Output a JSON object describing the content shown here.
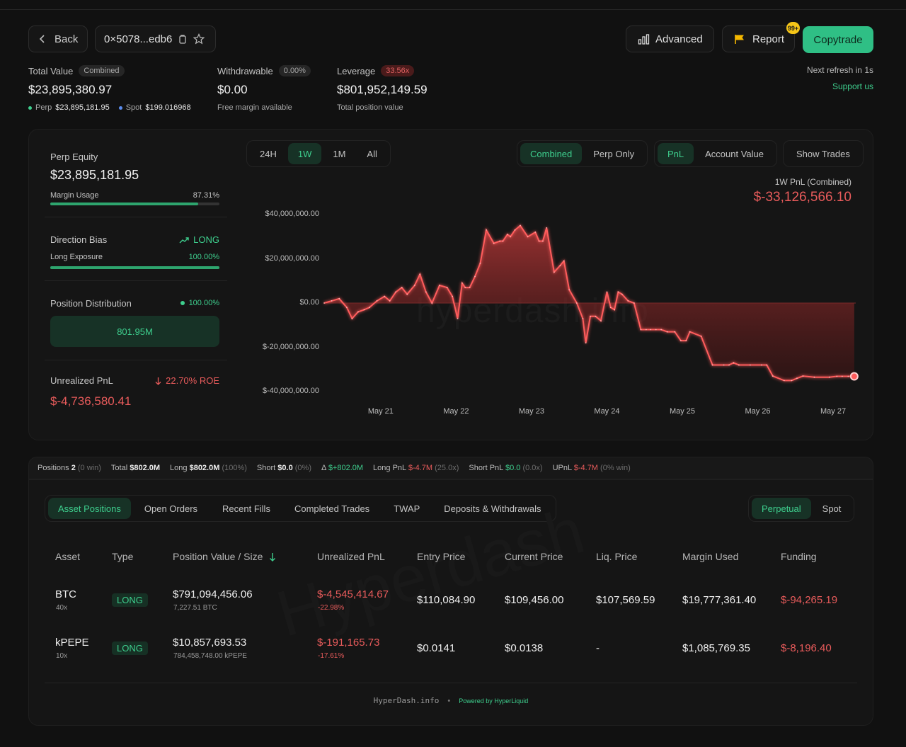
{
  "header": {
    "back_label": "Back",
    "address": "0×5078...edb6",
    "advanced_label": "Advanced",
    "report_label": "Report",
    "report_badge": "99+",
    "copytrade_label": "Copytrade"
  },
  "stats": {
    "total_value_label": "Total Value",
    "total_value_pill": "Combined",
    "total_value": "$23,895,380.97",
    "perp_label": "Perp",
    "perp_value": "$23,895,181.95",
    "spot_label": "Spot",
    "spot_value": "$199.016968",
    "withdrawable_label": "Withdrawable",
    "withdrawable_pill": "0.00%",
    "withdrawable_value": "$0.00",
    "withdrawable_sub": "Free margin available",
    "leverage_label": "Leverage",
    "leverage_pill": "33.56x",
    "leverage_value": "$801,952,149.59",
    "leverage_sub": "Total position value",
    "refresh_text": "Next refresh in 1s",
    "support_text": "Support us"
  },
  "left_panel": {
    "perp_equity_label": "Perp Equity",
    "perp_equity_value": "$23,895,181.95",
    "margin_usage_label": "Margin Usage",
    "margin_usage_value": "87.31%",
    "margin_usage_fraction": 0.8731,
    "direction_bias_label": "Direction Bias",
    "direction_bias_value": "LONG",
    "long_exposure_label": "Long Exposure",
    "long_exposure_value": "100.00%",
    "long_exposure_fraction": 1.0,
    "position_distribution_label": "Position Distribution",
    "position_distribution_value": "100.00%",
    "distribution_box_value": "801.95M",
    "unrealized_pnl_label": "Unrealized PnL",
    "unrealized_roe": "22.70% ROE",
    "unrealized_pnl_value": "$-4,736,580.41"
  },
  "chart_controls": {
    "timeframes": [
      "24H",
      "1W",
      "1M",
      "All"
    ],
    "active_timeframe": "1W",
    "modes": [
      "Combined",
      "Perp Only"
    ],
    "active_mode": "Combined",
    "metrics": [
      "PnL",
      "Account Value"
    ],
    "active_metric": "PnL",
    "show_trades_label": "Show Trades",
    "pnl_caption": "1W PnL (Combined)",
    "pnl_value": "$-33,126,566.10",
    "watermark": "hyperdash.info"
  },
  "chart_data": {
    "type": "area",
    "ytick_labels": [
      "$40,000,000.00",
      "$20,000,000.00",
      "$0.00",
      "$-20,000,000.00",
      "$-40,000,000.00"
    ],
    "yticks": [
      40000000,
      20000000,
      0,
      -20000000,
      -40000000
    ],
    "xtick_labels": [
      "May 21",
      "May 22",
      "May 23",
      "May 24",
      "May 25",
      "May 26",
      "May 27"
    ],
    "ylim": [
      -45000000,
      45000000
    ],
    "xlim": [
      0.25,
      7.3
    ],
    "x": [
      0.25,
      0.35,
      0.45,
      0.55,
      0.62,
      0.7,
      0.78,
      0.85,
      0.95,
      1.05,
      1.12,
      1.2,
      1.28,
      1.35,
      1.45,
      1.52,
      1.6,
      1.68,
      1.78,
      1.88,
      1.95,
      2.02,
      2.08,
      2.12,
      2.18,
      2.25,
      2.32,
      2.4,
      2.5,
      2.58,
      2.62,
      2.68,
      2.72,
      2.78,
      2.85,
      2.95,
      3.05,
      3.1,
      3.15,
      3.2,
      3.3,
      3.38,
      3.43,
      3.5,
      3.6,
      3.68,
      3.72,
      3.78,
      3.85,
      3.92,
      4.0,
      4.05,
      4.1,
      4.15,
      4.2,
      4.28,
      4.36,
      4.45,
      4.52,
      4.58,
      4.65,
      4.72,
      4.8,
      4.9,
      4.98,
      5.05,
      5.1,
      5.25,
      5.4,
      5.55,
      5.62,
      5.68,
      5.75,
      5.9,
      6.05,
      6.12,
      6.2,
      6.35,
      6.45,
      6.52,
      6.6,
      6.75,
      6.95,
      7.05,
      7.12,
      7.2,
      7.28
    ],
    "y": [
      0,
      1000000,
      2000000,
      -2000000,
      -7000000,
      -4000000,
      -3000000,
      -2000000,
      1000000,
      3000000,
      1000000,
      5000000,
      7000000,
      4000000,
      8000000,
      13000000,
      5000000,
      0,
      8000000,
      7000000,
      3000000,
      -7000000,
      9000000,
      7000000,
      7000000,
      12000000,
      18000000,
      33000000,
      27000000,
      28000000,
      28000000,
      31000000,
      30000000,
      33000000,
      35000000,
      30000000,
      32000000,
      28000000,
      28000000,
      34000000,
      14000000,
      17000000,
      19000000,
      6000000,
      0,
      -7000000,
      -18000000,
      -6000000,
      -6000000,
      -8000000,
      5000000,
      -2000000,
      -3000000,
      5000000,
      4000000,
      1000000,
      0,
      -12000000,
      -12000000,
      -12000000,
      -12000000,
      -12000000,
      -13000000,
      -13000000,
      -17000000,
      -17000000,
      -13000000,
      -15000000,
      -28000000,
      -28000000,
      -28000000,
      -27000000,
      -28000000,
      -28000000,
      -28000000,
      -28000000,
      -33000000,
      -35000000,
      -35000000,
      -34000000,
      -33000000,
      -33500000,
      -33500000,
      -33126566,
      -33126566,
      -33126566,
      -33126566
    ]
  },
  "summary": {
    "positions_label": "Positions",
    "positions_value": "2",
    "positions_win": "(0 win)",
    "total_label": "Total",
    "total_value": "$802.0M",
    "long_label": "Long",
    "long_value": "$802.0M",
    "long_pct": "(100%)",
    "short_label": "Short",
    "short_value": "$0.0",
    "short_pct": "(0%)",
    "delta_label": "Δ",
    "delta_value": "$+802.0M",
    "long_pnl_label": "Long PnL",
    "long_pnl_value": "$-4.7M",
    "long_pnl_x": "(25.0x)",
    "short_pnl_label": "Short PnL",
    "short_pnl_value": "$0.0",
    "short_pnl_x": "(0.0x)",
    "upnl_label": "UPnL",
    "upnl_value": "$-4.7M",
    "upnl_win": "(0% win)"
  },
  "tabs": {
    "items": [
      "Asset Positions",
      "Open Orders",
      "Recent Fills",
      "Completed Trades",
      "TWAP",
      "Deposits & Withdrawals"
    ],
    "active": "Asset Positions",
    "market_types": [
      "Perpetual",
      "Spot"
    ],
    "active_market": "Perpetual"
  },
  "table": {
    "headers": [
      "Asset",
      "Type",
      "Position Value / Size",
      "Unrealized PnL",
      "Entry Price",
      "Current Price",
      "Liq. Price",
      "Margin Used",
      "Funding"
    ],
    "rows": [
      {
        "asset": "BTC",
        "leverage": "40x",
        "type": "LONG",
        "value": "$791,094,456.06",
        "size": "7,227.51 BTC",
        "upnl": "$-4,545,414.67",
        "upnl_pct": "-22.98%",
        "entry": "$110,084.90",
        "current": "$109,456.00",
        "liq": "$107,569.59",
        "margin": "$19,777,361.40",
        "funding": "$-94,265.19"
      },
      {
        "asset": "kPEPE",
        "leverage": "10x",
        "type": "LONG",
        "value": "$10,857,693.53",
        "size": "784,458,748.00 kPEPE",
        "upnl": "$-191,165.73",
        "upnl_pct": "-17.61%",
        "entry": "$0.0141",
        "current": "$0.0138",
        "liq": "-",
        "margin": "$1,085,769.35",
        "funding": "$-8,196.40"
      }
    ],
    "watermark": "Hyperdash"
  },
  "footer": {
    "site": "HyperDash.info",
    "separator": "•",
    "powered": "Powered by HyperLiquid"
  },
  "colors": {
    "accent_green": "#3ecf8e",
    "negative_red": "#e85b5b",
    "copytrade_bg": "#2fbf85",
    "badge_yellow": "#f5c518"
  }
}
